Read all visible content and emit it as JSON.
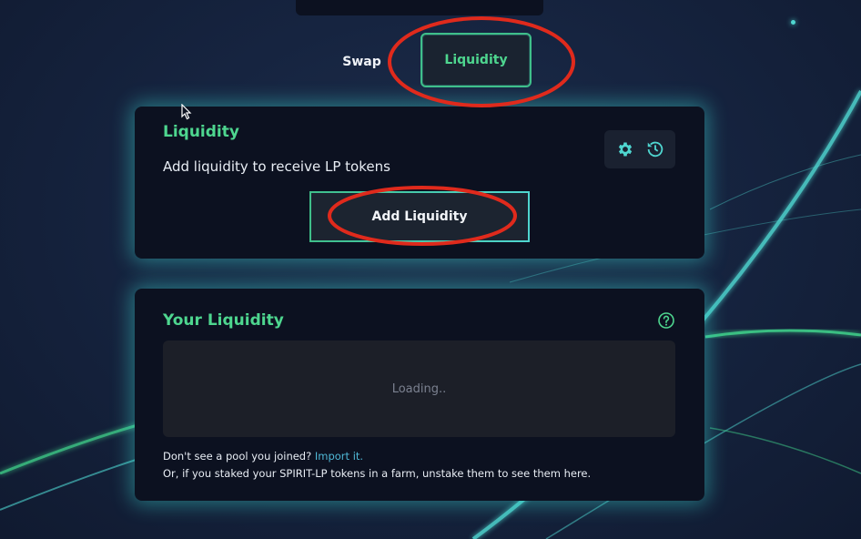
{
  "nav": {
    "tabs": [
      {
        "label": "Swap",
        "active": false
      },
      {
        "label": "Liquidity",
        "active": true
      }
    ]
  },
  "liquidity_card": {
    "title": "Liquidity",
    "subtitle": "Add liquidity to receive LP tokens",
    "add_button_label": "Add Liquidity",
    "settings_icon": "gear-icon",
    "history_icon": "history-icon"
  },
  "your_liquidity": {
    "title": "Your Liquidity",
    "help_icon": "question-circle-icon",
    "loading_text": "Loading..",
    "footer_line1_prefix": "Don't see a pool you joined?",
    "import_link": "Import it.",
    "footer_line2": "Or, if you staked your SPIRIT-LP tokens in a farm, unstake them to see them here."
  },
  "colors": {
    "accent_green": "#4ed68f",
    "accent_cyan": "#4fd6d0",
    "card_bg": "#0c1120",
    "annotation_red": "#e02a1c"
  }
}
